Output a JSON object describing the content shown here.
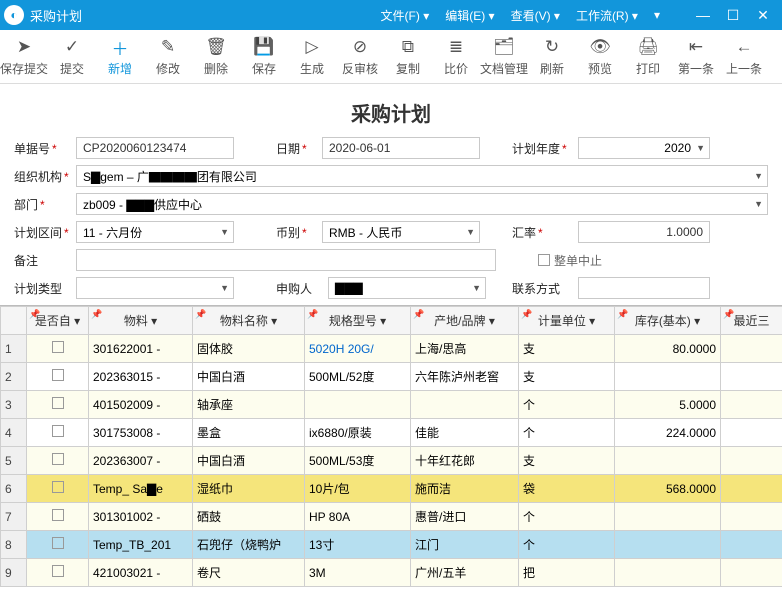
{
  "titlebar": {
    "title": "采购计划",
    "menus": [
      {
        "label": "文件(F)"
      },
      {
        "label": "编辑(E)"
      },
      {
        "label": "查看(V)"
      },
      {
        "label": "工作流(R)"
      }
    ]
  },
  "toolbar": [
    {
      "name": "save-submit",
      "label": "保存提交",
      "glyph": "➤"
    },
    {
      "name": "submit",
      "label": "提交",
      "glyph": "✓"
    },
    {
      "name": "add",
      "label": "新增",
      "glyph": "＋",
      "highlight": true
    },
    {
      "name": "modify",
      "label": "修改",
      "glyph": "✎"
    },
    {
      "name": "delete",
      "label": "删除",
      "glyph": "🗑"
    },
    {
      "name": "save",
      "label": "保存",
      "glyph": "💾"
    },
    {
      "name": "generate",
      "label": "生成",
      "glyph": "▷"
    },
    {
      "name": "anti-audit",
      "label": "反审核",
      "glyph": "⊘"
    },
    {
      "name": "copy",
      "label": "复制",
      "glyph": "⧉"
    },
    {
      "name": "compare-price",
      "label": "比价",
      "glyph": "≣"
    },
    {
      "name": "doc-manage",
      "label": "文档管理",
      "glyph": "🗂"
    },
    {
      "name": "refresh",
      "label": "刷新",
      "glyph": "↻"
    },
    {
      "name": "preview",
      "label": "预览",
      "glyph": "👁"
    },
    {
      "name": "print",
      "label": "打印",
      "glyph": "🖨"
    },
    {
      "name": "first",
      "label": "第一条",
      "glyph": "⇤"
    },
    {
      "name": "prev",
      "label": "上一条",
      "glyph": "←"
    }
  ],
  "page_title": "采购计划",
  "form": {
    "doc_no_label": "单据号",
    "doc_no": "CP2020060123474",
    "date_label": "日期",
    "date": "2020-06-01",
    "plan_year_label": "计划年度",
    "plan_year": "2020",
    "org_label": "组织机构",
    "org": "S▇gem – 广▇▇▇▇团有限公司",
    "dept_label": "部门",
    "dept": "zb009 - ▇▇▇供应中心",
    "plan_range_label": "计划区间",
    "plan_range": "11 - 六月份",
    "currency_label": "币别",
    "currency": "RMB - 人民币",
    "rate_label": "汇率",
    "rate": "1.0000",
    "remark_label": "备注",
    "remark": "",
    "whole_stop_label": "整单中止",
    "plan_type_label": "计划类型",
    "plan_type": "",
    "applicant_label": "申购人",
    "applicant": "▇▇▇",
    "contact_label": "联系方式",
    "contact": ""
  },
  "table": {
    "headers": {
      "free": "是否自",
      "material": "物料",
      "material_name": "物料名称",
      "spec": "规格型号",
      "origin": "产地/品牌",
      "unit": "计量单位",
      "stock": "库存(基本)",
      "last": "最近三"
    },
    "rows": [
      {
        "n": "1",
        "material": "301622001 -",
        "name": "固体胶",
        "spec": "5020H 20G/",
        "spec_link": true,
        "origin": "上海/思高",
        "unit": "支",
        "stock": "80.0000"
      },
      {
        "n": "2",
        "material": "202363015 -",
        "name": "中国白酒",
        "spec": "500ML/52度",
        "origin": "六年陈泸州老窖",
        "unit": "支",
        "stock": ""
      },
      {
        "n": "3",
        "material": "401502009 -",
        "name": "轴承座",
        "spec": "",
        "origin": "",
        "unit": "个",
        "stock": "5.0000"
      },
      {
        "n": "4",
        "material": "301753008 -",
        "name": "墨盒",
        "spec": "ix6880/原装",
        "origin": "佳能",
        "unit": "个",
        "stock": "224.0000"
      },
      {
        "n": "5",
        "material": "202363007 -",
        "name": "中国白酒",
        "spec": "500ML/53度",
        "origin": "十年红花郎",
        "unit": "支",
        "stock": ""
      },
      {
        "n": "6",
        "material": "Temp_ Sa▇e",
        "name": "湿纸巾",
        "spec": "10片/包",
        "origin": "施而洁",
        "unit": "袋",
        "stock": "568.0000",
        "class": "row-yellow"
      },
      {
        "n": "7",
        "material": "301301002 -",
        "name": "硒鼓",
        "spec": "HP 80A",
        "origin": "惠普/进口",
        "unit": "个",
        "stock": ""
      },
      {
        "n": "8",
        "material": "Temp_TB_201",
        "name": "石兜仔（烧鸭炉",
        "spec": "13寸",
        "origin": "江门",
        "unit": "个",
        "stock": "",
        "class": "row-blue"
      },
      {
        "n": "9",
        "material": "421003021 -",
        "name": "卷尺",
        "spec": "3M",
        "origin": "广州/五羊",
        "unit": "把",
        "stock": ""
      }
    ]
  }
}
